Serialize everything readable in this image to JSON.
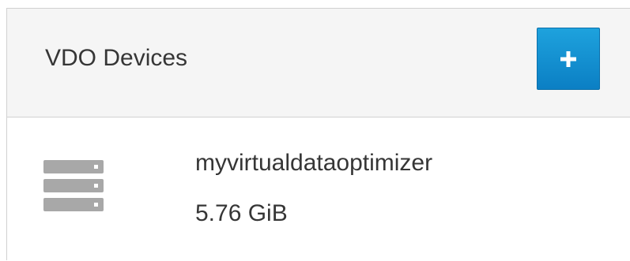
{
  "panel": {
    "title": "VDO Devices",
    "add_button": {
      "icon": "plus-icon",
      "color": "#1a95d6"
    }
  },
  "devices": [
    {
      "icon": "server-storage-icon",
      "name": "myvirtualdataoptimizer",
      "size": "5.76 GiB"
    }
  ]
}
